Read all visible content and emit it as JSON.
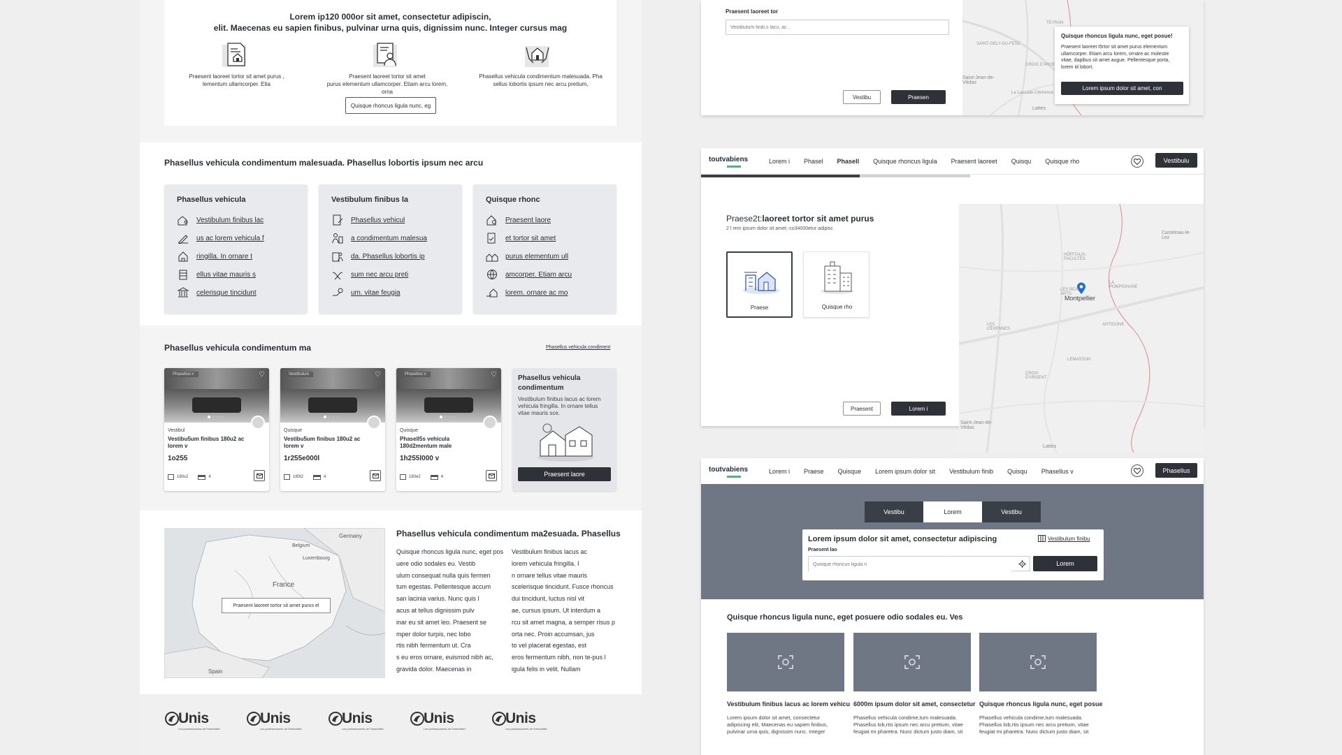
{
  "left": {
    "features": {
      "title_line1": "Lorem ip120 000or sit amet, consectetur adipiscin,",
      "title_line2": "elit. Maecenas eu sapien finibus, pulvinar urna quis, dignissim nunc. Integer cursus mag",
      "items": [
        {
          "l1": "Praesent laoreet tortor sit amet purus ,",
          "l2": "lementum ullamcorper. Etia",
          "l3": "",
          "icon": "document-house-icon"
        },
        {
          "l1": "Praesent laoreet tortor sit amet",
          "l2": "purus elementum ullamcorper. Etiam arcu lorem,",
          "l3": "orna",
          "icon": "document-person-icon"
        },
        {
          "l1": "Phasellus vehicula condimentum malesuada. Pha",
          "l2": "sellus lobortis ipsum nec arcu pretium,",
          "l3": "",
          "icon": "hands-house-icon"
        }
      ],
      "button": "Quisque rhoncus ligula nunc, eg"
    },
    "categories": {
      "title": "Phasellus vehicula condimentum malesuada. Phasellus lobortis ipsum nec arcu",
      "cards": [
        {
          "title": "Phasellus vehicula",
          "links": [
            "Vestibulum finibus lac",
            "us ac lorem vehicula f",
            "ringilla. In ornare t",
            "ellus vitae mauris s",
            "celerisque tincidunt"
          ]
        },
        {
          "title": "Vestibulum finibus la",
          "links": [
            "Phasellus vehicul",
            "a condimentum malesua",
            "da. Phasellus lobortis ip",
            "sum nec arcu preti",
            "um. vitae feugia"
          ]
        },
        {
          "title": "Quisque rhonc",
          "links": [
            "Praesent laore",
            "et tortor sit amet",
            " purus elementum ull",
            "amcorper. Etiam arcu",
            "lorem. ornare ac mo"
          ]
        }
      ]
    },
    "listings": {
      "title": "Phasellus vehicula condimentum ma",
      "see_all": "Phasellus vehicula condiment",
      "cards": [
        {
          "tag": "Phasellus v",
          "type": "Vestibul",
          "title1": "Vestibu5um finibus 180u2 ac",
          "title2": "lorem v",
          "price": "1o255",
          "area": "180s2",
          "rooms": "4"
        },
        {
          "tag": "Vestibulum",
          "type": "Quisque",
          "title1": "Vestibu5um finibus 180u2 ac",
          "title2": "lorem v",
          "price": "1r255e000l",
          "area": "180t2",
          "rooms": "4"
        },
        {
          "tag": "Phasellus v",
          "type": "Quisque",
          "title1": "Phasell5s vehicula",
          "title2": "180d2mentum male",
          "price": "1h255l000 v",
          "area": "180e2",
          "rooms": "4"
        }
      ],
      "promo": {
        "title1": "Phasellus vehicula",
        "title2": "condimentum",
        "text1": "Vestibulum finibus lacus ac lorem",
        "text2": "vehicula fringilla. In ornare tellus",
        "text3": "vitae mauris sce.",
        "button": "Praesent laore"
      }
    },
    "map_section": {
      "title": "Phasellus vehicula condimentum ma2esuada. Phasellus",
      "map_labels": [
        "Germany",
        "Belgium",
        "Luxembourg",
        "France",
        "Spain"
      ],
      "popup": "Praesent laoreet tortor sit amet purus el",
      "col1": [
        "Quisque rhoncus ligula nunc, eget pos",
        "uere odio sodales eu. Vestib",
        "ulum consequat nulla quis fermen",
        "tum egestas. Pellentesque accum",
        "san lacinia varius. Nunc quis l",
        "acus at tellus dignissim pulv",
        "inar eu sit amet leo. Praesent se",
        "mper dolor turpis, nec lobo",
        "rtis nibh fermentum ut. Cra",
        "s eu eros ornare, euismod nibh ac,",
        " gravida dolor. Maecenas in"
      ],
      "col2": [
        "Vestibulum finibus lacus ac",
        " lorem vehicula fringilla. I",
        "n ornare tellus vitae mauris",
        " scelerisque tincidunt. Fusce rhoncus",
        " dui tincidunt, luctus nisl vit",
        "ae, cursus ipsum. Ut interdum a",
        "rcu sit amet magna, a semper risus p",
        "orta nec. Proin accumsan, jus",
        "to vel placerat egestas, est",
        " eros fermentum nibh, non te-pus l",
        "igula felis in velit. Nullam"
      ]
    },
    "logo_text": "Unis",
    "logo_sub": "Les professionnels de l'immobilier"
  },
  "right": {
    "top_form": {
      "label": "Praesent laoreet tor",
      "placeholder": "Vestibulum finib,s lacu, ac .",
      "btn_light": "Vestibu",
      "btn_dark": "Praesen",
      "map_labels": [
        "SAINT-GELY-DU-FESC",
        "TEYRAN",
        "CROIX D'ARGENT",
        "Saint-Jean-de-Védas",
        "Lattes",
        "La Lauzade-Clémence"
      ],
      "popup": {
        "title": "Quisque rhoncus ligula nunc, eget posue!",
        "text1": "Praesent laoreet t5rtor sit amet purus elementum",
        "text2": "ullamcorper. Etiam arcu lorem, ornare ac molestie",
        "text3": "vitae, dapibus sit amet augue. Pellentesque porta,",
        "text4": "lorem id lobort.",
        "button": "Lorem ipsum dolor sit amet, con"
      }
    },
    "step_screen": {
      "brand": "toutvabiens",
      "nav": [
        "Lorem i",
        "Phasel",
        "Phasell",
        "Quisque rhoncus ligula",
        "Praesent laoreet",
        "Quisqu",
        "Quisque rho"
      ],
      "cta": "Vestibulu",
      "title_prefix": "Praese2t:",
      "title_rest": "laoreet tortor sit amet purus",
      "subtitle": "2 l rem ipsum dolor sit amet,-co34000etur adipisc",
      "options": [
        {
          "label": "Praese",
          "selected": true
        },
        {
          "label": "Quisque rho",
          "selected": false
        }
      ],
      "city": "Montpellier",
      "map_labels": [
        "Castelnau-le-Lez",
        "Saint-Jean-de-Védas",
        "Lattes",
        "CROIX D'ARGENT",
        "LES BEAUX-ARTS",
        "ANTIGONE",
        "HÔPITAUX-FACULTÉS",
        "LES CÉVENNES",
        "LEMASSON",
        "LA POMPIGNANE"
      ],
      "btn_light": "Praesent",
      "btn_dark": "Lorem i",
      "progress": 0.59
    },
    "search_screen": {
      "brand": "toutvabiens",
      "nav": [
        "Lorem i",
        "Praese",
        "Quisque",
        "Lorem ipsum dolor sit",
        "Vestibulum finib",
        "Quisqu",
        "Phasellus v"
      ],
      "cta": "Phasellus",
      "tabs": [
        "Vestibu",
        "Lorem",
        "Vestibu"
      ],
      "active_tab": 1,
      "search_title": "Lorem ipsum dolor sit amet, consectetur adipiscing",
      "search_link": "Vestibulum finibu",
      "search_label": "Praesent lao",
      "search_placeholder": "Quisque rhoncus ligula n",
      "search_button": "Lorem",
      "section_title": "Quisque rhoncus ligula nunc, eget posuere odio sodales eu. Ves",
      "cards": [
        {
          "title": "Vestibulum finibus lacus ac lorem vehicu",
          "l1": "Lorem ipsum dolor sit amet, consectetur",
          "l2": "adipiscing elit, Maecenas eu sapien finibus,",
          "l3": "pulvinar urna quis, dignissim nunc. Integer"
        },
        {
          "title": "6000m ipsum dolor sit amet, consectetur",
          "l1": "Phasellus vehicula condime,tum malesuada.",
          "l2": "Phasellus lob,rtis ipsum nec arcu pretium, vitae",
          "l3": "feugiat mi pharetra. Nunc dictum justo diam, sit"
        },
        {
          "title": "Quisque rhoncus ligula nunc, eget posue",
          "l1": "Phasellus vehicula condime,tum malesuada.",
          "l2": "Phasellus lob,rtis ipsum nec arcu pretium, vitae",
          "l3": "feugiat mi pharetra. Nunc dictum justo diam, sit"
        }
      ]
    }
  }
}
